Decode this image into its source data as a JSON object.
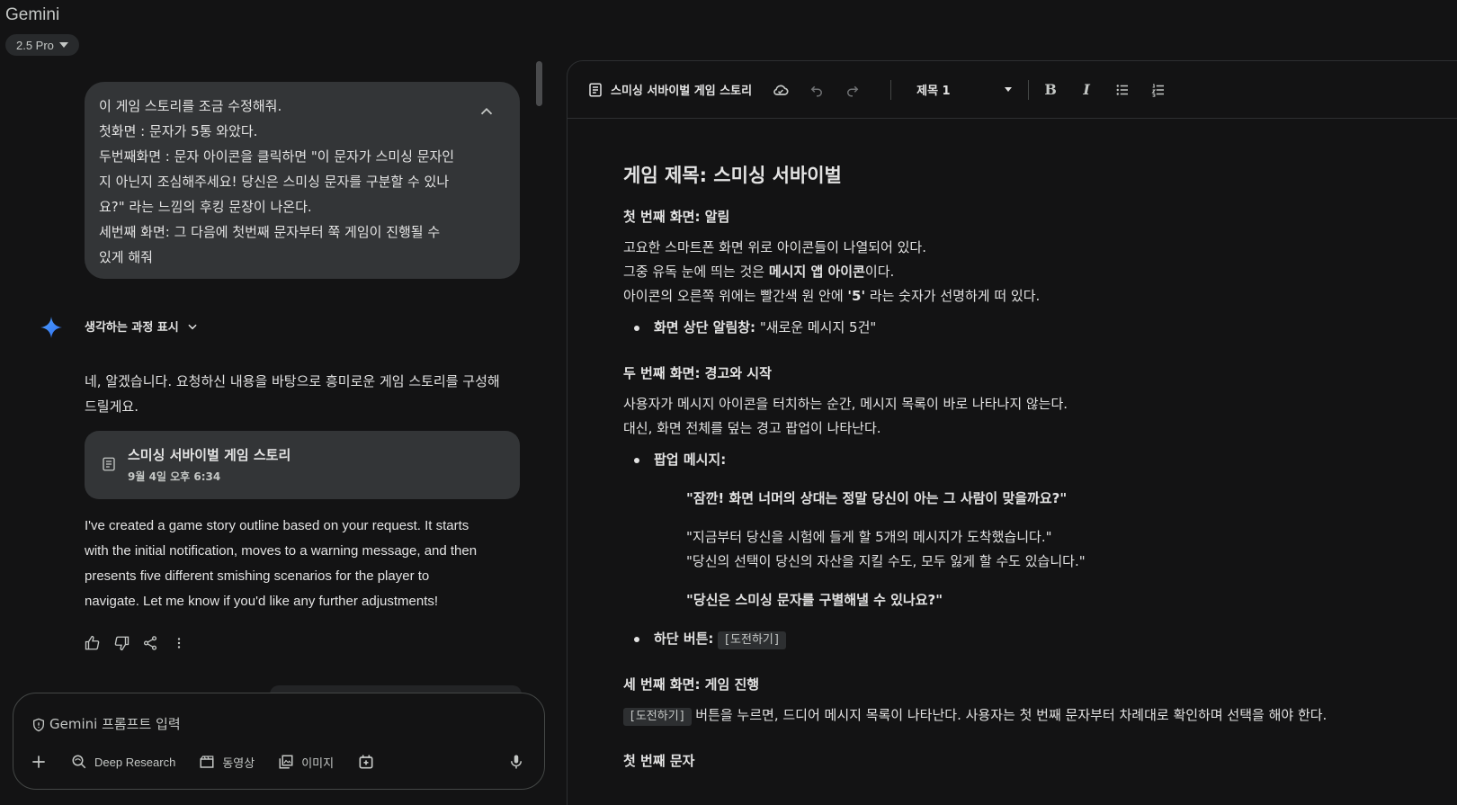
{
  "app": {
    "title": "Gemini",
    "model": "2.5 Pro"
  },
  "user_message": {
    "lines": [
      "이 게임 스토리를 조금 수정해줘.",
      "첫화면 : 문자가 5통 와았다.",
      "두번째화면 : 문자 아이콘을 클릭하면 \"이 문자가 스미싱 문자인",
      "지 아닌지 조심해주세요! 당신은 스미싱 문자를 구분할 수 있나",
      "요?\" 라는 느낌의 후킹 문장이 나온다.",
      "세번째 화면: 그 다음에 첫번째 문자부터 쭉 게임이 진행될 수",
      "있게 해줘"
    ]
  },
  "thinking": {
    "label": "생각하는 과정 표시"
  },
  "answer": {
    "lines": [
      "네, 알겠습니다. 요청하신 내용을 바탕으로 흥미로운 게임 스토리를 구성해",
      "드릴게요."
    ]
  },
  "doc_card": {
    "title": "스미싱 서바이벌 게임 스토리",
    "date": "9월 4일 오후 6:34"
  },
  "reply_en": {
    "lines": [
      "I've created a game story outline based on your request. It starts",
      "with the initial notification, moves to a warning message, and then",
      "presents five different smishing scenarios for the player to",
      "navigate. Let me know if you'd like any further adjustments!"
    ]
  },
  "prompt": {
    "placeholder": "Gemini 프롬프트 입력",
    "tools": {
      "deep_research": "Deep Research",
      "video": "동영상",
      "image": "이미지"
    }
  },
  "editor": {
    "doc_title": "스미싱 서바이벌 게임 스토리",
    "heading_style": "제목 1",
    "bold": "B",
    "italic": "I"
  },
  "doc": {
    "h1": "게임 제목: 스미싱 서바이벌",
    "s1": {
      "heading": "첫 번째 화면: 알림",
      "p1": "고요한 스마트폰 화면 위로 아이콘들이 나열되어 있다.",
      "p2_pre": "그중 유독 눈에 띄는 것은 ",
      "p2_bold": "메시지 앱 아이콘",
      "p2_post": "이다.",
      "p3_pre": "아이콘의 오른쪽 위에는 빨간색 원 안에 ",
      "p3_bold": "'5'",
      "p3_post": " 라는 숫자가 선명하게 떠 있다.",
      "bullet_label": "화면 상단 알림창:",
      "bullet_text": " \"새로운 메시지 5건\""
    },
    "s2": {
      "heading": "두 번째 화면: 경고와 시작",
      "p1": "사용자가 메시지 아이콘을 터치하는 순간, 메시지 목록이 바로 나타나지 않는다.",
      "p2": "대신, 화면 전체를 덮는 경고 팝업이 나타난다.",
      "popup_label": "팝업 메시지:",
      "q1": "\"잠깐! 화면 너머의 상대는 정말 당신이 아는 그 사람이 맞을까요?\"",
      "q2": "\"지금부터 당신을 시험에 들게 할 5개의 메시지가 도착했습니다.\"",
      "q3": "\"당신의 선택이 당신의 자산을 지킬 수도, 모두 잃게 할 수도 있습니다.\"",
      "q4": "\"당신은 스미싱 문자를 구별해낼 수 있나요?\"",
      "button_label": "하단 버튼:",
      "button_chip": "[도전하기]"
    },
    "s3": {
      "heading": "세 번째 화면: 게임 진행",
      "chip": "[도전하기]",
      "text": " 버튼을 누르면, 드디어 메시지 목록이 나타난다. 사용자는 첫 번째 문자부터 차례대로 확인하며 선택을 해야 한다."
    },
    "s4": {
      "heading": "첫 번째 문자"
    }
  }
}
